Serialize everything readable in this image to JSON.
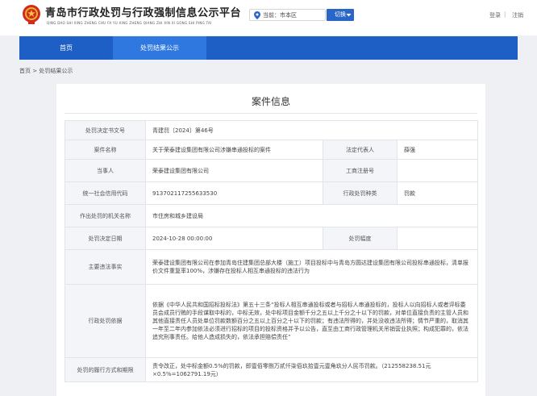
{
  "header": {
    "site_title": "青岛市行政处罚与行政强制信息公示平台",
    "site_subtitle": "QING DAO SHI XING ZHENG CHU FA YU XING ZHENG QIANG ZHI XIN XI GONG SHI PING TAI",
    "location_label": "当前：市本区",
    "switch_label": "切换",
    "login_label": "登录",
    "separator": "|",
    "logout_label": "注销",
    "brand_color": "#1e5fc6"
  },
  "nav": {
    "items": [
      {
        "label": "首页",
        "active": false
      },
      {
        "label": "处罚结果公示",
        "active": true
      }
    ]
  },
  "breadcrumb": "首页 > 处罚结果公示",
  "panel": {
    "title": "案件信息",
    "rows": [
      {
        "label": "处罚决定书文号",
        "value": "青建罚〔2024〕第46号"
      },
      {
        "label": "案件名称",
        "value": "关于荣泰建设集团有限公司涉嫌串通投标的案件",
        "label2": "法定代表人",
        "value2": "薛强"
      },
      {
        "label": "当事人",
        "value": "荣泰建设集团有限公司",
        "label2": "工商注册号",
        "value2": ""
      },
      {
        "label": "统一社会信用代码",
        "value": "913702117255633530",
        "label2": "行政处罚种类",
        "value2": "罚款"
      },
      {
        "label": "作出处罚的机关名称",
        "value": "市住房和城乡建设局"
      },
      {
        "label": "处罚决定日期",
        "value": "2024-10-28 00:00:00",
        "label2": "处罚幅度",
        "value2": ""
      },
      {
        "label": "主要违法事实",
        "value": "荣泰建设集团有限公司在参加青岛住建集团总部大楼（施工）项目投标中与青岛方圆达建设集团有限公司投标串通投标，清单报价文件重复率100%，涉嫌存在投标人相互串通投标的违法行为"
      },
      {
        "label": "行政处罚依据",
        "value": "依据《中华人民共和国招标投标法》第五十三条“投标人相互串通投标或者与招标人串通投标的，投标人以向招标人或者评标委员会成员行贿的手段谋取中标的，中标无效，处中标项目金额千分之五以上千分之十以下的罚款，对单位直接负责的主管人员和其他直接责任人员处单位罚款数额百分之五以上百分之十以下的罚款；有违法所得的，并处没收违法所得；情节严重的，取消其一年至二年内参加依法必须进行招标的项目的投标资格并予以公告，直至由工商行政管理机关吊销营业执照；构成犯罪的，依法追究刑事责任。给他人造成损失的，依法承担赔偿责任”"
      },
      {
        "label": "处罚的履行方式和期限",
        "value": "责令改正，处中标金额0.5%的罚款，即壹佰零捌万贰仟柒佰玖拾壹元壹角玖分人民币罚款。（212558238.51元×0.5%=1062791.19元）"
      }
    ]
  }
}
